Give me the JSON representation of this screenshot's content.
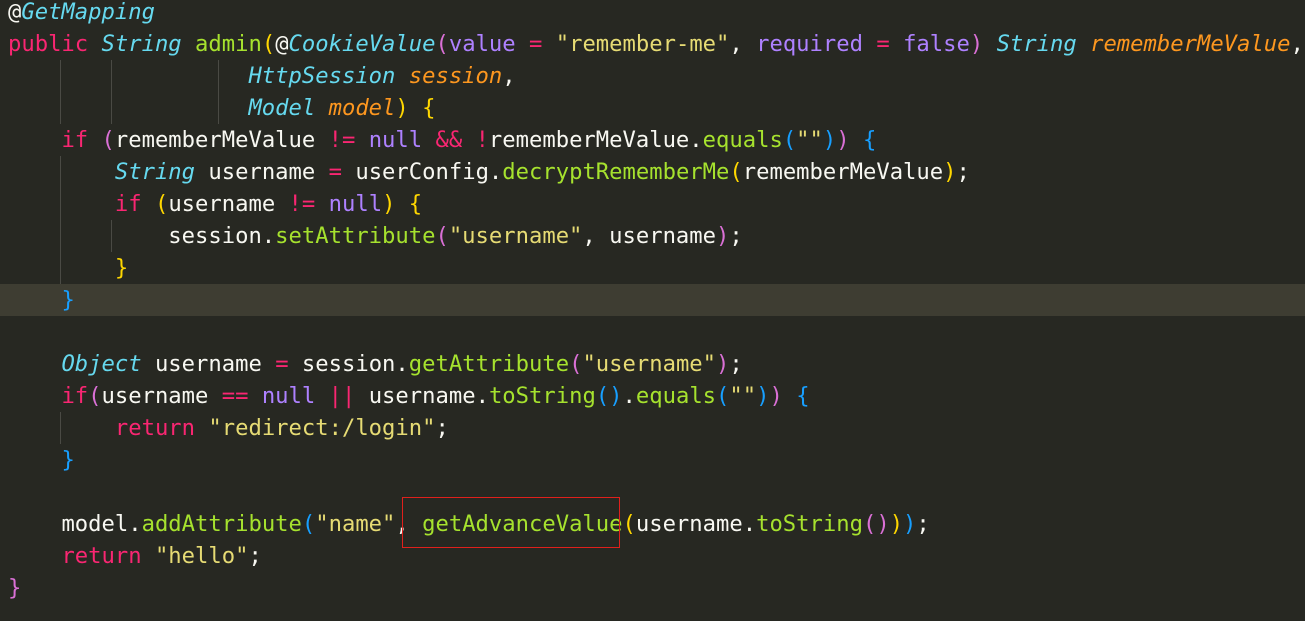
{
  "editor": {
    "highlight_color": "#e0201c",
    "lines": [
      {
        "tokens": [
          {
            "t": "@",
            "c": "plain"
          },
          {
            "t": "GetMapping",
            "c": "type"
          }
        ]
      },
      {
        "tokens": [
          {
            "t": "public ",
            "c": "kw"
          },
          {
            "t": "String ",
            "c": "type"
          },
          {
            "t": "admin",
            "c": "fn"
          },
          {
            "t": "(",
            "c": "b1"
          },
          {
            "t": "@",
            "c": "plain"
          },
          {
            "t": "CookieValue",
            "c": "type"
          },
          {
            "t": "(",
            "c": "b2"
          },
          {
            "t": "value ",
            "c": "const"
          },
          {
            "t": "= ",
            "c": "op"
          },
          {
            "t": "\"remember-me\"",
            "c": "str"
          },
          {
            "t": ", ",
            "c": "plain"
          },
          {
            "t": "required ",
            "c": "const"
          },
          {
            "t": "= ",
            "c": "op"
          },
          {
            "t": "false",
            "c": "const"
          },
          {
            "t": ") ",
            "c": "b2"
          },
          {
            "t": "String ",
            "c": "type"
          },
          {
            "t": "rememberMeValue",
            "c": "param"
          },
          {
            "t": ",",
            "c": "plain"
          }
        ]
      },
      {
        "tokens": [
          {
            "t": "                  ",
            "c": "plain"
          },
          {
            "t": "HttpSession ",
            "c": "type"
          },
          {
            "t": "session",
            "c": "param"
          },
          {
            "t": ",",
            "c": "plain"
          }
        ]
      },
      {
        "tokens": [
          {
            "t": "                  ",
            "c": "plain"
          },
          {
            "t": "Model ",
            "c": "type"
          },
          {
            "t": "model",
            "c": "param"
          },
          {
            "t": ") ",
            "c": "b1"
          },
          {
            "t": "{",
            "c": "b1"
          }
        ]
      },
      {
        "tokens": [
          {
            "t": "    ",
            "c": "plain"
          },
          {
            "t": "if ",
            "c": "kw"
          },
          {
            "t": "(",
            "c": "b2"
          },
          {
            "t": "rememberMeValue ",
            "c": "plain"
          },
          {
            "t": "!= ",
            "c": "op"
          },
          {
            "t": "null ",
            "c": "const"
          },
          {
            "t": "&& ",
            "c": "op"
          },
          {
            "t": "!",
            "c": "op"
          },
          {
            "t": "rememberMeValue.",
            "c": "plain"
          },
          {
            "t": "equals",
            "c": "fn"
          },
          {
            "t": "(",
            "c": "b3"
          },
          {
            "t": "\"\"",
            "c": "str"
          },
          {
            "t": ")",
            "c": "b3"
          },
          {
            "t": ") ",
            "c": "b2"
          },
          {
            "t": "{",
            "c": "b3"
          }
        ]
      },
      {
        "tokens": [
          {
            "t": "        ",
            "c": "plain"
          },
          {
            "t": "String ",
            "c": "type"
          },
          {
            "t": "username ",
            "c": "plain"
          },
          {
            "t": "= ",
            "c": "op"
          },
          {
            "t": "userConfig.",
            "c": "plain"
          },
          {
            "t": "decryptRememberMe",
            "c": "fn"
          },
          {
            "t": "(",
            "c": "b1"
          },
          {
            "t": "rememberMeValue",
            "c": "plain"
          },
          {
            "t": ")",
            "c": "b1"
          },
          {
            "t": ";",
            "c": "plain"
          }
        ]
      },
      {
        "tokens": [
          {
            "t": "        ",
            "c": "plain"
          },
          {
            "t": "if ",
            "c": "kw"
          },
          {
            "t": "(",
            "c": "b1"
          },
          {
            "t": "username ",
            "c": "plain"
          },
          {
            "t": "!= ",
            "c": "op"
          },
          {
            "t": "null",
            "c": "const"
          },
          {
            "t": ") ",
            "c": "b1"
          },
          {
            "t": "{",
            "c": "b1"
          }
        ]
      },
      {
        "tokens": [
          {
            "t": "            ",
            "c": "plain"
          },
          {
            "t": "session.",
            "c": "plain"
          },
          {
            "t": "setAttribute",
            "c": "fn"
          },
          {
            "t": "(",
            "c": "b2"
          },
          {
            "t": "\"username\"",
            "c": "str"
          },
          {
            "t": ", ",
            "c": "plain"
          },
          {
            "t": "username",
            "c": "plain"
          },
          {
            "t": ")",
            "c": "b2"
          },
          {
            "t": ";",
            "c": "plain"
          }
        ]
      },
      {
        "tokens": [
          {
            "t": "        ",
            "c": "plain"
          },
          {
            "t": "}",
            "c": "b1"
          }
        ]
      },
      {
        "current": true,
        "tokens": [
          {
            "t": "    ",
            "c": "plain"
          },
          {
            "t": "}",
            "c": "b3"
          }
        ]
      },
      {
        "tokens": []
      },
      {
        "tokens": [
          {
            "t": "    ",
            "c": "plain"
          },
          {
            "t": "Object ",
            "c": "type"
          },
          {
            "t": "username ",
            "c": "plain"
          },
          {
            "t": "= ",
            "c": "op"
          },
          {
            "t": "session.",
            "c": "plain"
          },
          {
            "t": "getAttribute",
            "c": "fn"
          },
          {
            "t": "(",
            "c": "b2"
          },
          {
            "t": "\"username\"",
            "c": "str"
          },
          {
            "t": ")",
            "c": "b2"
          },
          {
            "t": ";",
            "c": "plain"
          }
        ]
      },
      {
        "tokens": [
          {
            "t": "    ",
            "c": "plain"
          },
          {
            "t": "if",
            "c": "kw"
          },
          {
            "t": "(",
            "c": "b2"
          },
          {
            "t": "username ",
            "c": "plain"
          },
          {
            "t": "== ",
            "c": "op"
          },
          {
            "t": "null ",
            "c": "const"
          },
          {
            "t": "|| ",
            "c": "op"
          },
          {
            "t": "username.",
            "c": "plain"
          },
          {
            "t": "toString",
            "c": "fn"
          },
          {
            "t": "()",
            "c": "b3"
          },
          {
            "t": ".",
            "c": "plain"
          },
          {
            "t": "equals",
            "c": "fn"
          },
          {
            "t": "(",
            "c": "b3"
          },
          {
            "t": "\"\"",
            "c": "str"
          },
          {
            "t": ")",
            "c": "b3"
          },
          {
            "t": ") ",
            "c": "b2"
          },
          {
            "t": "{",
            "c": "b3"
          }
        ]
      },
      {
        "tokens": [
          {
            "t": "        ",
            "c": "plain"
          },
          {
            "t": "return ",
            "c": "kw"
          },
          {
            "t": "\"redirect:/login\"",
            "c": "str"
          },
          {
            "t": ";",
            "c": "plain"
          }
        ]
      },
      {
        "tokens": [
          {
            "t": "    ",
            "c": "plain"
          },
          {
            "t": "}",
            "c": "b3"
          }
        ]
      },
      {
        "tokens": []
      },
      {
        "tokens": [
          {
            "t": "    ",
            "c": "plain"
          },
          {
            "t": "model.",
            "c": "plain"
          },
          {
            "t": "addAttribute",
            "c": "fn"
          },
          {
            "t": "(",
            "c": "b3"
          },
          {
            "t": "\"name\"",
            "c": "str"
          },
          {
            "t": ", ",
            "c": "plain"
          },
          {
            "t": "getAdvanceValue",
            "c": "fn"
          },
          {
            "t": "(",
            "c": "b1"
          },
          {
            "t": "username.",
            "c": "plain"
          },
          {
            "t": "toString",
            "c": "fn"
          },
          {
            "t": "()",
            "c": "b2"
          },
          {
            "t": ")",
            "c": "b1"
          },
          {
            "t": ")",
            "c": "b3"
          },
          {
            "t": ";",
            "c": "plain"
          }
        ]
      },
      {
        "tokens": [
          {
            "t": "    ",
            "c": "plain"
          },
          {
            "t": "return ",
            "c": "kw"
          },
          {
            "t": "\"hello\"",
            "c": "str"
          },
          {
            "t": ";",
            "c": "plain"
          }
        ]
      },
      {
        "tokens": [
          {
            "t": "}",
            "c": "b2"
          }
        ]
      }
    ]
  }
}
